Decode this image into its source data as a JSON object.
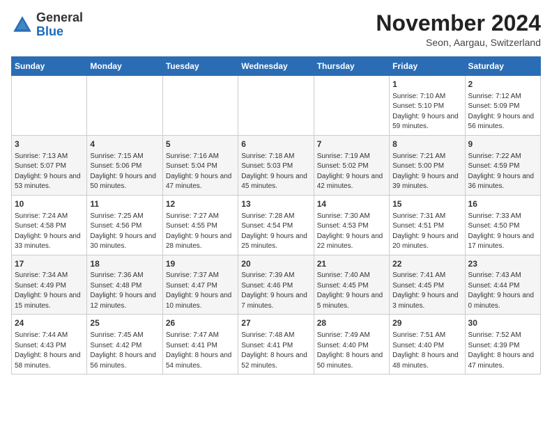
{
  "logo": {
    "general": "General",
    "blue": "Blue"
  },
  "header": {
    "month": "November 2024",
    "location": "Seon, Aargau, Switzerland"
  },
  "weekdays": [
    "Sunday",
    "Monday",
    "Tuesday",
    "Wednesday",
    "Thursday",
    "Friday",
    "Saturday"
  ],
  "weeks": [
    [
      {
        "day": "",
        "info": ""
      },
      {
        "day": "",
        "info": ""
      },
      {
        "day": "",
        "info": ""
      },
      {
        "day": "",
        "info": ""
      },
      {
        "day": "",
        "info": ""
      },
      {
        "day": "1",
        "info": "Sunrise: 7:10 AM\nSunset: 5:10 PM\nDaylight: 9 hours and 59 minutes."
      },
      {
        "day": "2",
        "info": "Sunrise: 7:12 AM\nSunset: 5:09 PM\nDaylight: 9 hours and 56 minutes."
      }
    ],
    [
      {
        "day": "3",
        "info": "Sunrise: 7:13 AM\nSunset: 5:07 PM\nDaylight: 9 hours and 53 minutes."
      },
      {
        "day": "4",
        "info": "Sunrise: 7:15 AM\nSunset: 5:06 PM\nDaylight: 9 hours and 50 minutes."
      },
      {
        "day": "5",
        "info": "Sunrise: 7:16 AM\nSunset: 5:04 PM\nDaylight: 9 hours and 47 minutes."
      },
      {
        "day": "6",
        "info": "Sunrise: 7:18 AM\nSunset: 5:03 PM\nDaylight: 9 hours and 45 minutes."
      },
      {
        "day": "7",
        "info": "Sunrise: 7:19 AM\nSunset: 5:02 PM\nDaylight: 9 hours and 42 minutes."
      },
      {
        "day": "8",
        "info": "Sunrise: 7:21 AM\nSunset: 5:00 PM\nDaylight: 9 hours and 39 minutes."
      },
      {
        "day": "9",
        "info": "Sunrise: 7:22 AM\nSunset: 4:59 PM\nDaylight: 9 hours and 36 minutes."
      }
    ],
    [
      {
        "day": "10",
        "info": "Sunrise: 7:24 AM\nSunset: 4:58 PM\nDaylight: 9 hours and 33 minutes."
      },
      {
        "day": "11",
        "info": "Sunrise: 7:25 AM\nSunset: 4:56 PM\nDaylight: 9 hours and 30 minutes."
      },
      {
        "day": "12",
        "info": "Sunrise: 7:27 AM\nSunset: 4:55 PM\nDaylight: 9 hours and 28 minutes."
      },
      {
        "day": "13",
        "info": "Sunrise: 7:28 AM\nSunset: 4:54 PM\nDaylight: 9 hours and 25 minutes."
      },
      {
        "day": "14",
        "info": "Sunrise: 7:30 AM\nSunset: 4:53 PM\nDaylight: 9 hours and 22 minutes."
      },
      {
        "day": "15",
        "info": "Sunrise: 7:31 AM\nSunset: 4:51 PM\nDaylight: 9 hours and 20 minutes."
      },
      {
        "day": "16",
        "info": "Sunrise: 7:33 AM\nSunset: 4:50 PM\nDaylight: 9 hours and 17 minutes."
      }
    ],
    [
      {
        "day": "17",
        "info": "Sunrise: 7:34 AM\nSunset: 4:49 PM\nDaylight: 9 hours and 15 minutes."
      },
      {
        "day": "18",
        "info": "Sunrise: 7:36 AM\nSunset: 4:48 PM\nDaylight: 9 hours and 12 minutes."
      },
      {
        "day": "19",
        "info": "Sunrise: 7:37 AM\nSunset: 4:47 PM\nDaylight: 9 hours and 10 minutes."
      },
      {
        "day": "20",
        "info": "Sunrise: 7:39 AM\nSunset: 4:46 PM\nDaylight: 9 hours and 7 minutes."
      },
      {
        "day": "21",
        "info": "Sunrise: 7:40 AM\nSunset: 4:45 PM\nDaylight: 9 hours and 5 minutes."
      },
      {
        "day": "22",
        "info": "Sunrise: 7:41 AM\nSunset: 4:45 PM\nDaylight: 9 hours and 3 minutes."
      },
      {
        "day": "23",
        "info": "Sunrise: 7:43 AM\nSunset: 4:44 PM\nDaylight: 9 hours and 0 minutes."
      }
    ],
    [
      {
        "day": "24",
        "info": "Sunrise: 7:44 AM\nSunset: 4:43 PM\nDaylight: 8 hours and 58 minutes."
      },
      {
        "day": "25",
        "info": "Sunrise: 7:45 AM\nSunset: 4:42 PM\nDaylight: 8 hours and 56 minutes."
      },
      {
        "day": "26",
        "info": "Sunrise: 7:47 AM\nSunset: 4:41 PM\nDaylight: 8 hours and 54 minutes."
      },
      {
        "day": "27",
        "info": "Sunrise: 7:48 AM\nSunset: 4:41 PM\nDaylight: 8 hours and 52 minutes."
      },
      {
        "day": "28",
        "info": "Sunrise: 7:49 AM\nSunset: 4:40 PM\nDaylight: 8 hours and 50 minutes."
      },
      {
        "day": "29",
        "info": "Sunrise: 7:51 AM\nSunset: 4:40 PM\nDaylight: 8 hours and 48 minutes."
      },
      {
        "day": "30",
        "info": "Sunrise: 7:52 AM\nSunset: 4:39 PM\nDaylight: 8 hours and 47 minutes."
      }
    ]
  ]
}
